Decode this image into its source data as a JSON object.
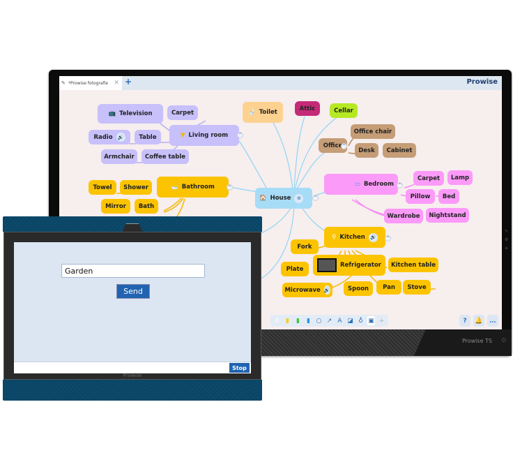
{
  "big_display": {
    "tab": {
      "title": "*Prowise fotografie",
      "lock_icon": "pencil-lock-icon",
      "close_icon": "close-icon"
    },
    "add_tab_label": "+",
    "brand": "Prowise",
    "bezel_brand": "Prowise TS",
    "mindmap": {
      "center": {
        "label": "House",
        "icon": "house-icon"
      },
      "nodes": {
        "television": "Television",
        "carpet_lr": "Carpet",
        "living_room": "Living room",
        "radio": "Radio",
        "table": "Table",
        "armchair": "Armchair",
        "coffee_table": "Coffee table",
        "towel": "Towel",
        "shower": "Shower",
        "bathroom": "Bathroom",
        "mirror": "Mirror",
        "bath": "Bath",
        "toilet": "Toilet",
        "attic": "Attic",
        "cellar": "Cellar",
        "office": "Office",
        "office_chair": "Office chair",
        "desk": "Desk",
        "cabinet": "Cabinet",
        "bedroom": "Bedroom",
        "carpet_bd": "Carpet",
        "lamp": "Lamp",
        "pillow": "Pillow",
        "bed": "Bed",
        "wardrobe": "Wardrobe",
        "nightstand": "Nightstand",
        "kitchen": "Kitchen",
        "fork": "Fork",
        "refrigerator": "Refrigerator",
        "kitchen_table": "Kitchen table",
        "plate": "Plate",
        "microwave": "Microwave",
        "spoon": "Spoon",
        "pan": "Pan",
        "stove": "Stove"
      }
    },
    "toolbar": {
      "tools": [
        "text-icon",
        "highlighter-yellow-icon",
        "marker-green-icon",
        "eraser-icon",
        "circle-icon",
        "arrow-icon",
        "letter-a-icon",
        "ruler-icon",
        "fill-icon",
        "select-icon",
        "move-icon"
      ],
      "help_label": "?",
      "more_label": "…"
    }
  },
  "small_display": {
    "input_value": "Garden",
    "send_label": "Send",
    "stop_label": "Stop",
    "brand": "Prowise"
  },
  "colors": {
    "living_room": "#c7c0fa",
    "bathroom": "#fcc400",
    "kitchen": "#fcc400",
    "bedroom": "#fb9af9",
    "office": "#c59d76",
    "house": "#a7dcf7",
    "toilet": "#fdd291",
    "attic": "#c52a78",
    "cellar": "#b6e923",
    "button_blue": "#2163b1"
  }
}
